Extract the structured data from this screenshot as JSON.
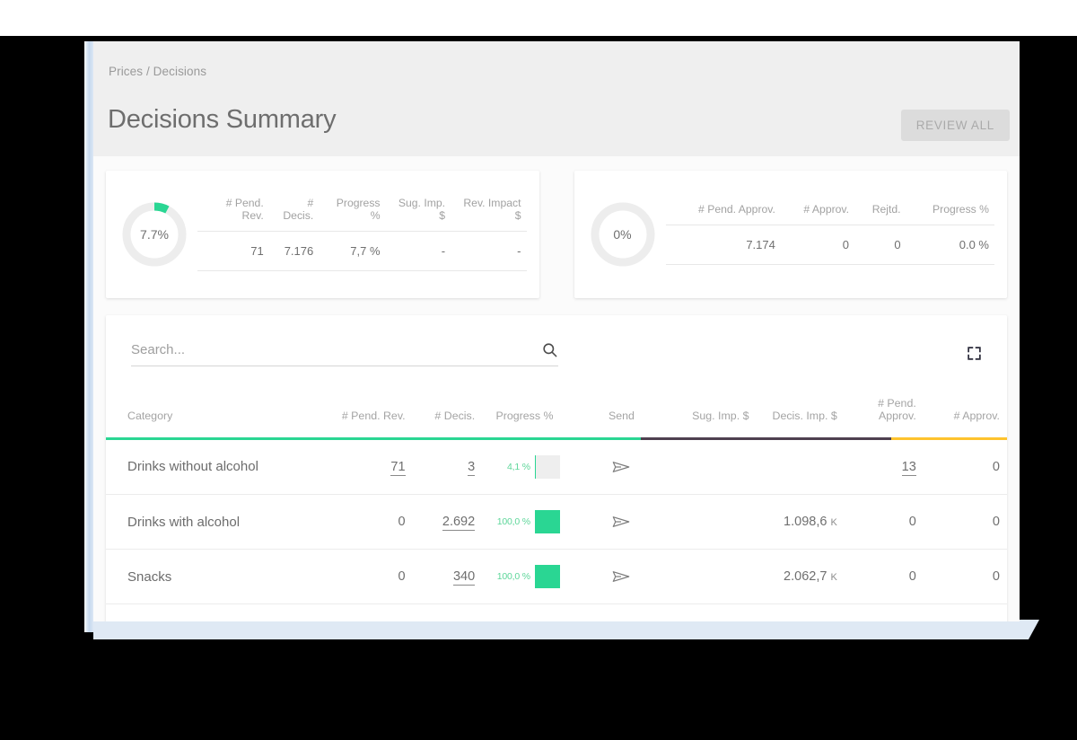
{
  "header": {
    "breadcrumb": "Prices / Decisions",
    "title": "Decisions Summary",
    "review_all_label": "REVIEW ALL"
  },
  "summary_cards": [
    {
      "name": "review-progress-card",
      "donut": {
        "label": "7.7%",
        "percent": 7.7,
        "arc_color": "#2ad693",
        "track_color": "#ededed"
      },
      "headers": [
        "# Pend. Rev.",
        "# Decis.",
        "Progress %",
        "Sug. Imp. $",
        "Rev. Impact $"
      ],
      "values": [
        "71",
        "7.176",
        "7,7 %",
        "-",
        "-"
      ]
    },
    {
      "name": "approval-progress-card",
      "donut": {
        "label": "0%",
        "percent": 0,
        "arc_color": "#2ad693",
        "track_color": "#ededed"
      },
      "headers": [
        "# Pend. Approv.",
        "# Approv.",
        "Rejtd.",
        "Progress %"
      ],
      "values": [
        "7.174",
        "0",
        "0",
        "0.0 %"
      ]
    }
  ],
  "search": {
    "value": "",
    "placeholder": "Search...",
    "icon": "search-icon"
  },
  "expand": {
    "icon": "fullscreen-icon"
  },
  "table": {
    "headers": [
      "Category",
      "# Pend. Rev.",
      "# Decis.",
      "Progress %",
      "Send",
      "Sug. Imp. $",
      "Decis. Imp. $",
      "# Pend. Approv.",
      "# Approv."
    ],
    "underline_segments": [
      {
        "color": "#2ad693",
        "flex": 565
      },
      {
        "color": "#4f4050",
        "flex": 265
      },
      {
        "color": "#fec32d",
        "flex": 122
      }
    ],
    "rows": [
      {
        "category": "Drinks without alcohol",
        "pend_rev": "71",
        "pend_rev_link": true,
        "decis": "3",
        "decis_link": true,
        "progress_pct": "4,1 %",
        "progress_value": 4.1,
        "send": "send-icon",
        "sug_imp": "",
        "sug_imp_unit": "",
        "decis_imp": "",
        "decis_imp_unit": "",
        "pend_approv": "13",
        "pend_approv_link": true,
        "approv": "0",
        "approv_link": false
      },
      {
        "category": "Drinks with alcohol",
        "pend_rev": "0",
        "pend_rev_link": false,
        "decis": "2.692",
        "decis_link": true,
        "progress_pct": "100,0 %",
        "progress_value": 100,
        "send": "send-icon",
        "sug_imp": "",
        "sug_imp_unit": "",
        "decis_imp": "1.098,6",
        "decis_imp_unit": "K",
        "pend_approv": "0",
        "pend_approv_link": false,
        "approv": "0",
        "approv_link": false
      },
      {
        "category": "Snacks",
        "pend_rev": "0",
        "pend_rev_link": false,
        "decis": "340",
        "decis_link": true,
        "progress_pct": "100,0 %",
        "progress_value": 100,
        "send": "send-icon",
        "sug_imp": "",
        "sug_imp_unit": "",
        "decis_imp": "2.062,7",
        "decis_imp_unit": "K",
        "pend_approv": "0",
        "pend_approv_link": false,
        "approv": "0",
        "approv_link": false
      }
    ]
  },
  "colors": {
    "accent_green": "#2ad693",
    "accent_dark": "#4f4050",
    "accent_yellow": "#fec32d",
    "header_bg": "#efefef",
    "panel_bg": "#fbfbfb"
  }
}
